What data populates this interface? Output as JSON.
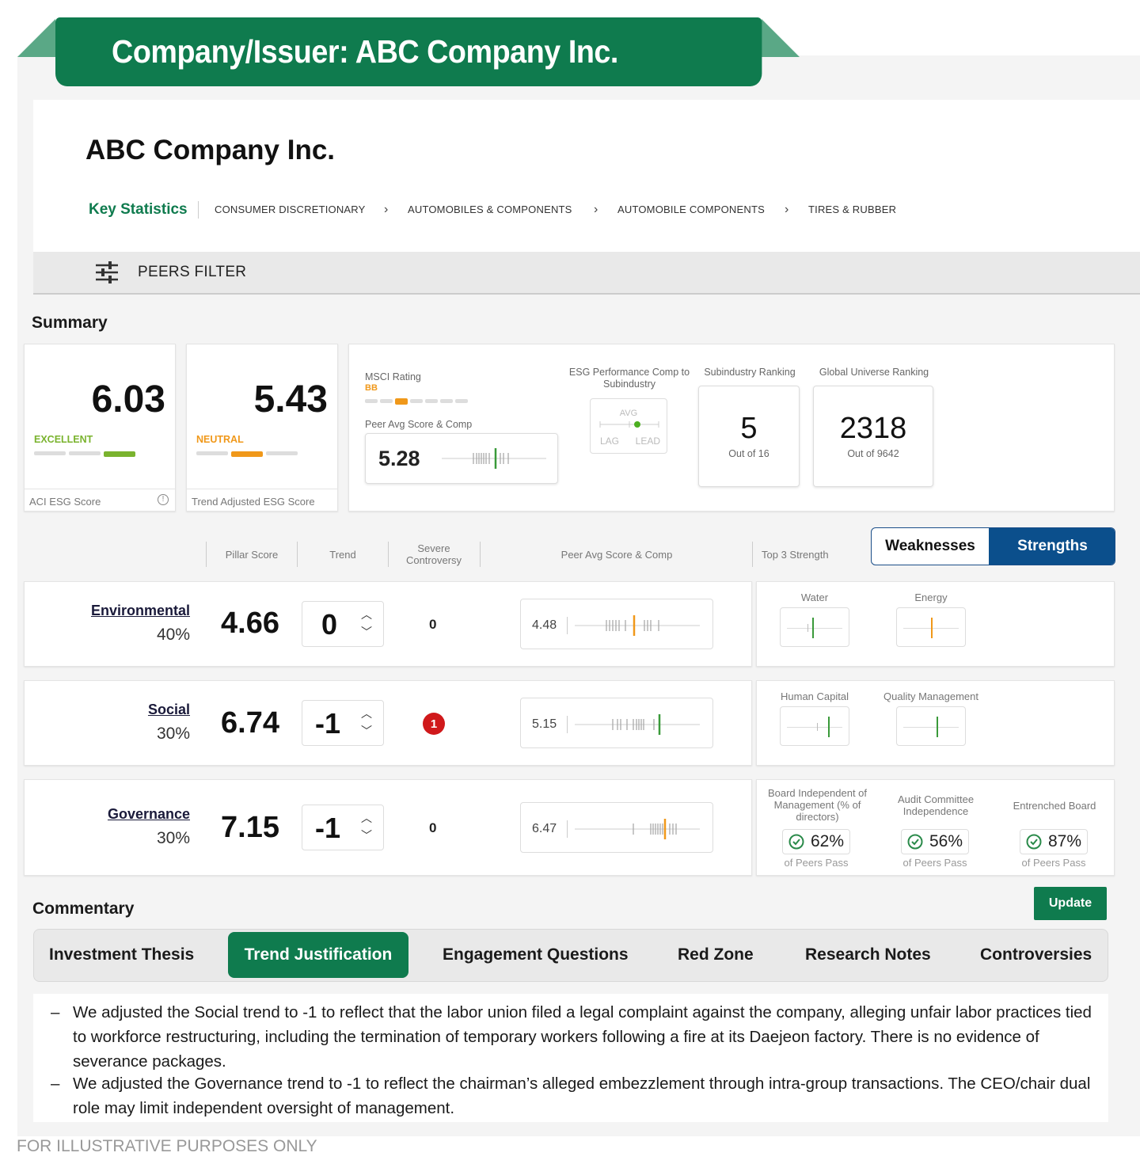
{
  "banner": {
    "title": "Company/Issuer: ABC Company Inc."
  },
  "company": {
    "name": "ABC Company Inc.",
    "key_stats_label": "Key Statistics",
    "breadcrumb": [
      "CONSUMER DISCRETIONARY",
      "AUTOMOBILES & COMPONENTS",
      "AUTOMOBILE COMPONENTS",
      "TIRES & RUBBER"
    ]
  },
  "peers_filter": {
    "label": "PEERS FILTER",
    "icon": "sliders-icon"
  },
  "summary": {
    "title": "Summary",
    "aci": {
      "score": "6.03",
      "band": "EXCELLENT",
      "label": "ACI ESG Score",
      "band_color": "#7ab32e",
      "level_of_4": 4
    },
    "trend_adjusted": {
      "score": "5.43",
      "band": "NEUTRAL",
      "label": "Trend Adjusted ESG Score",
      "band_color": "#f0981a",
      "level_of_4": 3
    },
    "msci": {
      "label": "MSCI Rating",
      "rating": "BB",
      "rating_color": "#f0981a",
      "level_of_7": 3
    },
    "peer_avg": {
      "label": "Peer Avg Score & Comp",
      "value": "5.28"
    },
    "esg_perf": {
      "label": "ESG Performance Comp to Subindustry",
      "avg": "AVG",
      "lag": "LAG",
      "lead": "LEAD"
    },
    "subindustry_rank": {
      "label": "Subindustry Ranking",
      "value": "5",
      "sub": "Out of 16"
    },
    "global_rank": {
      "label": "Global Universe Ranking",
      "value": "2318",
      "sub": "Out of 9642"
    }
  },
  "pillars_header": {
    "pillar_score": "Pillar Score",
    "trend": "Trend",
    "severe_controversy": "Severe Controversy",
    "peer_avg": "Peer Avg Score & Comp",
    "top3": "Top 3 Strength",
    "toggle": {
      "weaknesses": "Weaknesses",
      "strengths": "Strengths",
      "active": "strengths"
    }
  },
  "pillars": [
    {
      "name": "Environmental",
      "weight": "40%",
      "score": "4.66",
      "trend": "0",
      "controversy": "0",
      "peer_avg": "4.48",
      "strengths": [
        {
          "label": "Water",
          "color": "#3a9a3a"
        },
        {
          "label": "Energy",
          "color": "#f0981a"
        }
      ]
    },
    {
      "name": "Social",
      "weight": "30%",
      "score": "6.74",
      "trend": "-1",
      "controversy": "1",
      "peer_avg": "5.15",
      "strengths": [
        {
          "label": "Human Capital",
          "color": "#3a9a3a"
        },
        {
          "label": "Quality Management",
          "color": "#3a9a3a"
        }
      ]
    },
    {
      "name": "Governance",
      "weight": "30%",
      "score": "7.15",
      "trend": "-1",
      "controversy": "0",
      "peer_avg": "6.47",
      "strengths": [
        {
          "label": "Board Independent of Management (% of directors)",
          "value": "62%",
          "sub": "of Peers Pass"
        },
        {
          "label": "Audit Committee Independence",
          "value": "56%",
          "sub": "of Peers Pass"
        },
        {
          "label": "Entrenched Board",
          "value": "87%",
          "sub": "of Peers Pass"
        }
      ]
    }
  ],
  "commentary": {
    "title": "Commentary",
    "update_label": "Update",
    "tabs": [
      "Investment Thesis",
      "Trend Justification",
      "Engagement Questions",
      "Red Zone",
      "Research Notes",
      "Controversies"
    ],
    "active_tab": "Trend Justification",
    "bullets": [
      "We adjusted the Social trend to -1 to reflect that the labor union filed a legal complaint against the company, alleging unfair labor practices tied to workforce restructuring, including the termination of temporary workers following a fire at its Daejeon factory. There is no evidence of severance packages.",
      "We adjusted the Governance trend to -1 to reflect the chairman’s alleged embezzlement through intra-group transactions. The CEO/chair dual role may limit independent oversight of management."
    ]
  },
  "footer": {
    "disclaimer": "FOR ILLUSTRATIVE PURPOSES ONLY"
  }
}
